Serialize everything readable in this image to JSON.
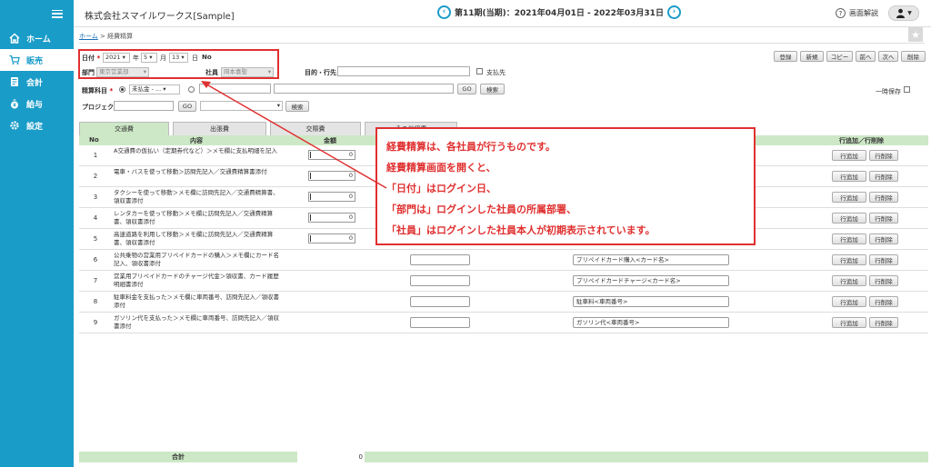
{
  "header": {
    "company": "株式会社スマイルワークス[Sample]",
    "period": "第11期(当期)：2021年04月01日 - 2022年03月31日",
    "prev_icon": "chevron-left-icon",
    "next_icon": "chevron-right-icon",
    "help": "画面解説",
    "user_icon": "user-icon"
  },
  "sidebar": {
    "items": [
      {
        "label": "ホーム",
        "icon": "home-icon"
      },
      {
        "label": "販売",
        "icon": "cart-icon"
      },
      {
        "label": "会計",
        "icon": "ledger-icon"
      },
      {
        "label": "給与",
        "icon": "moneybag-icon"
      },
      {
        "label": "設定",
        "icon": "gear-icon"
      }
    ]
  },
  "breadcrumb": {
    "home": "ホーム",
    "sep": " > ",
    "current": "経費精算"
  },
  "form": {
    "date_label": "日付",
    "required_mark": "*",
    "year": "2021",
    "year_unit": "年",
    "month": "5",
    "month_unit": "月",
    "day": "13",
    "day_unit": "日",
    "no_label": "No",
    "dept_label": "部門",
    "dept_value": "東京営業部",
    "staff_label": "社員",
    "staff_value": "岡本喜聖",
    "purpose_label": "目的・行先",
    "payee_label": "支払先",
    "account_label": "精算科目",
    "account_value": "未払金 - ...",
    "go": "GO",
    "search": "検索",
    "project_label": "プロジェクト",
    "temp_save": "一時保存"
  },
  "toolbar": [
    "登録",
    "新規",
    "コピー",
    "前へ",
    "次へ",
    "削除"
  ],
  "tabs": [
    "交通費",
    "出張費",
    "交際費",
    "その他経費"
  ],
  "table": {
    "headers": {
      "no": "No",
      "content": "内容",
      "amount": "金額",
      "rowaction": "行追加／行削除"
    },
    "add": "行追加",
    "del": "行削除",
    "rows": [
      {
        "no": "1",
        "desc": "A交通費の仮払い（定期券代など）＞メモ欄に支払明細を記入",
        "amount": "0",
        "memo": ""
      },
      {
        "no": "2",
        "desc": "電車・バスを使って移動＞訪問先記入／交通費精算書添付",
        "amount": "0",
        "memo": ""
      },
      {
        "no": "3",
        "desc": "タクシーを使って移動＞メモ欄に訪問先記入／交通費精算書、領収書添付",
        "amount": "0",
        "memo": ""
      },
      {
        "no": "4",
        "desc": "レンタカーを使って移動＞メモ欄に訪問先記入／交通費精算書、領収書添付",
        "amount": "0",
        "memo": ""
      },
      {
        "no": "5",
        "desc": "高速道路を利用して移動＞メモ欄に訪問先記入／交通費精算書、領収書添付",
        "amount": "0",
        "memo": ""
      },
      {
        "no": "6",
        "desc": "公共乗物の営業用プリペイドカードの購入＞メモ欄にカード名記入、領収書添付",
        "amount": "",
        "memo": "プリペイドカード購入<カード名>"
      },
      {
        "no": "7",
        "desc": "営業用プリペイドカードのチャージ代金＞領収書、カード履歴明細書添付",
        "amount": "",
        "memo": "プリペイドカードチャージ<カード名>"
      },
      {
        "no": "8",
        "desc": "駐車料金を支払った＞メモ欄に車両番号、訪問先記入／領収書添付",
        "amount": "",
        "memo": "駐車料<車両番号>"
      },
      {
        "no": "9",
        "desc": "ガソリン代を支払った＞メモ欄に車両番号、訪問先記入／領収書添付",
        "amount": "",
        "memo": "ガソリン代<車両番号>"
      }
    ]
  },
  "total": {
    "label": "合計",
    "value": "0"
  },
  "callout": {
    "lines": [
      "経費精算は、各社員が行うものです。",
      "経費精算画面を開くと、",
      "「日付」はログイン日、",
      "「部門は」ログインした社員の所属部署、",
      "「社員」はログインした社員本人が初期表示されています。"
    ]
  },
  "colors": {
    "sidebar": "#1a9cc9",
    "header_green": "#cde8c6",
    "annotation_red": "#e03030"
  }
}
